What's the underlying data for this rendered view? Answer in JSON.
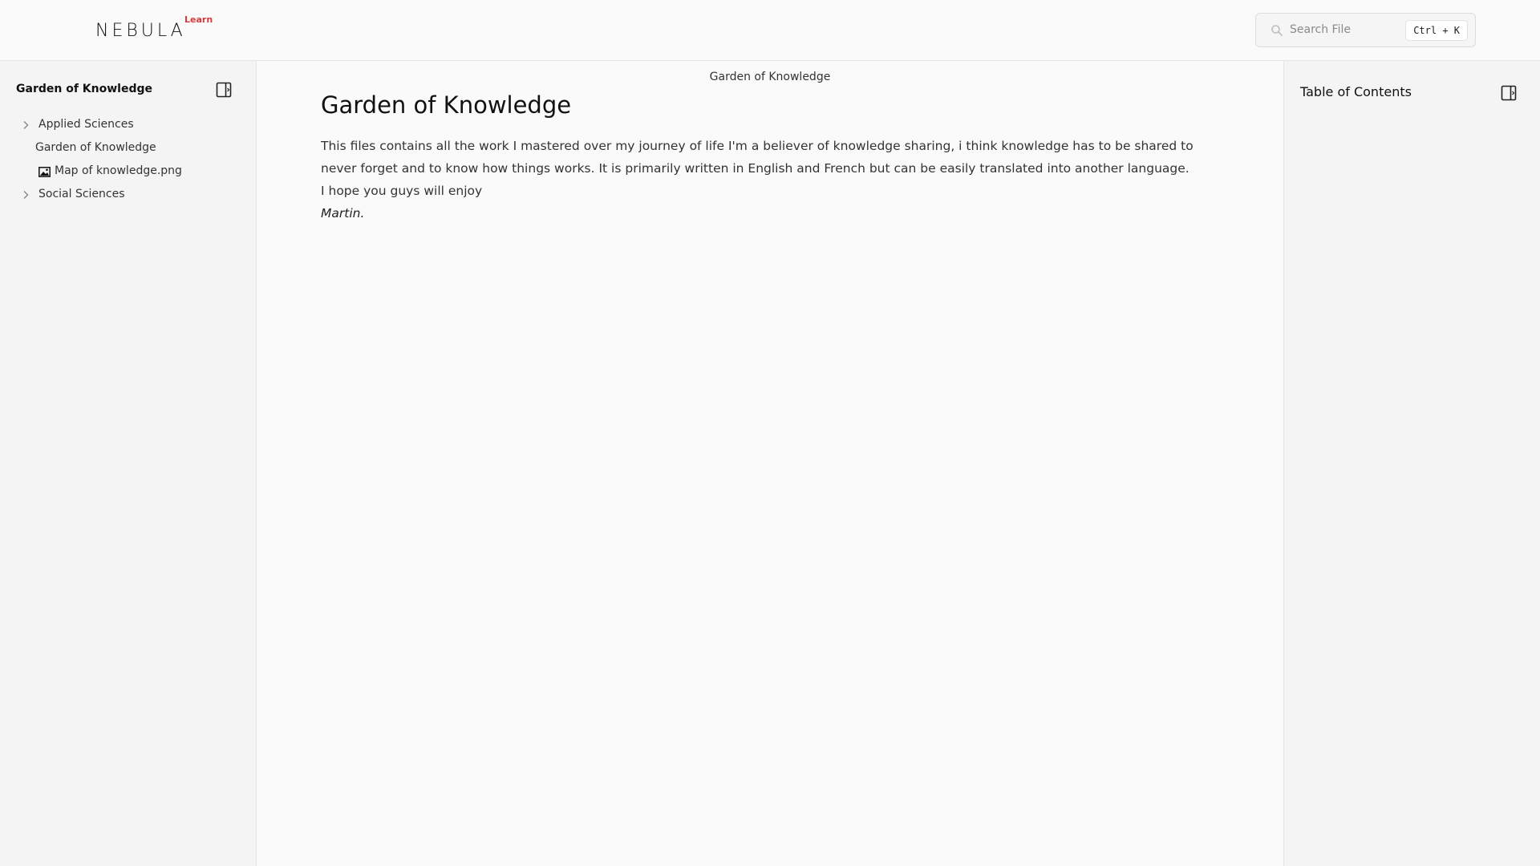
{
  "brand": {
    "name": "NEBULA",
    "sub": "Learn",
    "accent": "#d63a3a"
  },
  "search": {
    "placeholder": "Search File",
    "shortcut": "Ctrl + K"
  },
  "sidebar": {
    "title": "Garden of Knowledge",
    "items": [
      {
        "label": "Applied Sciences",
        "type": "folder",
        "icon": "chevron-right-icon"
      },
      {
        "label": "Garden of Knowledge",
        "type": "file"
      },
      {
        "label": "Map of knowledge.png",
        "type": "image",
        "icon": "image-icon"
      },
      {
        "label": "Social Sciences",
        "type": "folder",
        "icon": "chevron-right-icon"
      }
    ]
  },
  "main": {
    "breadcrumb": "Garden of Knowledge",
    "title": "Garden of Knowledge",
    "paragraph": "This files contains all the work I mastered over my journey of life I'm a believer of knowledge sharing, i think knowledge has to be shared to never forget and to know how things works. It is primarily written in English and French but can be easily translated into another language.",
    "line2": "I hope you guys will enjoy",
    "signature": "Martin."
  },
  "toc": {
    "title": "Table of Contents"
  }
}
